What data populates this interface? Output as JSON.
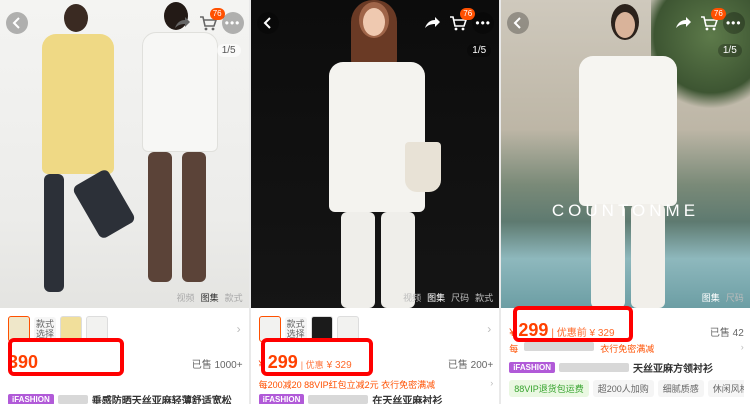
{
  "panels": [
    {
      "cart_badge": "76",
      "image_counter": "1/5",
      "media_tabs": [
        "视频",
        "图集",
        "款式"
      ],
      "sku_label": "款式\n选择",
      "price": "390",
      "sold": "已售 1000+",
      "shop_tag": "iFASHION",
      "title": "垂感防晒天丝亚麻轻薄舒适宽松"
    },
    {
      "cart_badge": "76",
      "image_counter": "1/5",
      "media_tabs": [
        "视频",
        "图集",
        "尺码",
        "款式"
      ],
      "sku_label": "款式\n选择",
      "currency": "¥",
      "price": "299",
      "pre_discount": "| 优惠",
      "original_price": "¥ 329",
      "sold": "已售 200+",
      "promo": "每200减20  88VIP红包立减2元  衣行免密满减",
      "shop_tag": "iFASHION",
      "title": "在天丝亚麻衬衫"
    },
    {
      "cart_badge": "76",
      "image_counter": "1/5",
      "media_tabs": [
        "图集",
        "尺码"
      ],
      "brand_overlay": "COUNTONME",
      "currency": "¥",
      "price": "299",
      "pre_discount": "| 优惠前 ¥ 329",
      "sold": "已售 42",
      "promo_left": "每",
      "promo": "衣行免密满减",
      "shop_tag": "iFASHION",
      "title": "天丝亚麻方领衬衫",
      "tags": [
        "88VIP退货包运费",
        "超200人加购",
        "细腻质感",
        "休闲风格"
      ]
    }
  ],
  "colors": {
    "price": "#ff4000",
    "highlight": "#ff0000",
    "accent": "#ff5000",
    "ifashion": "#b15ad8"
  },
  "icons": [
    "back-icon",
    "share-icon",
    "cart-icon",
    "more-icon",
    "chevron-right-icon"
  ]
}
